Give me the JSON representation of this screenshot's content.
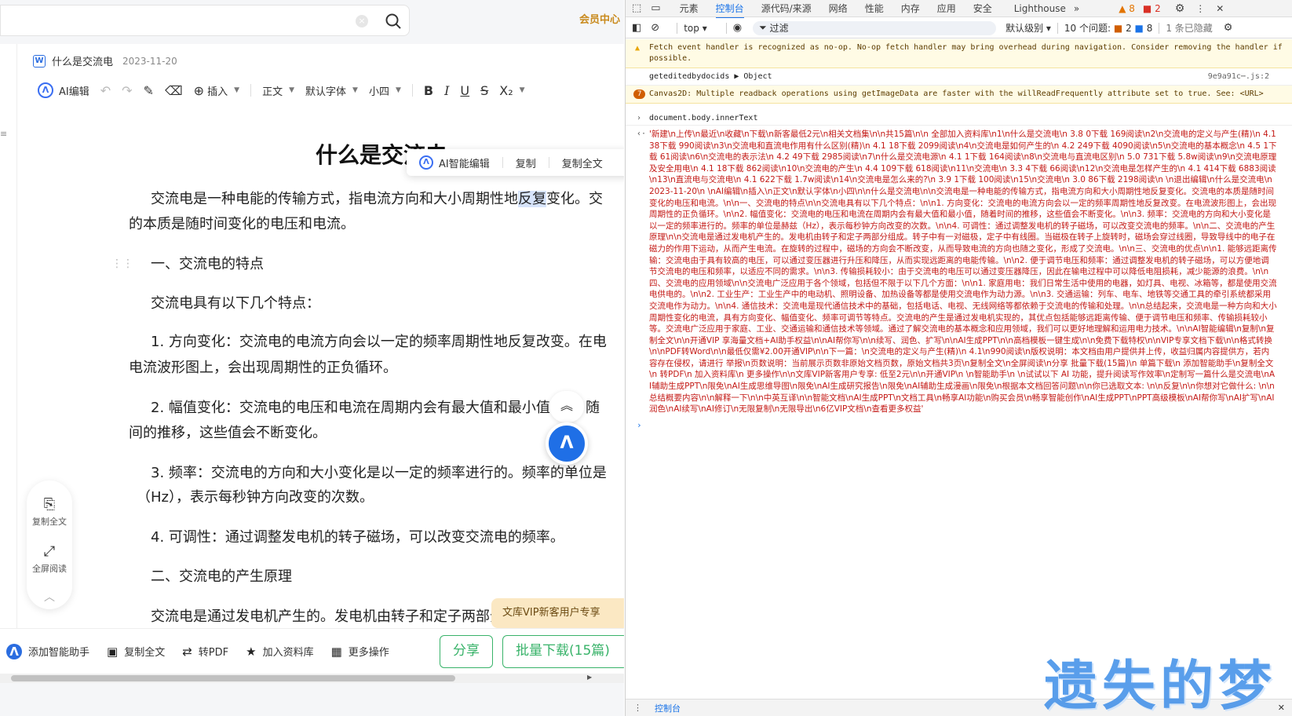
{
  "search": {
    "clear_icon": "×"
  },
  "top_right_link": "会员中心",
  "doc": {
    "file_name": "什么是交流电",
    "date": "2023-11-20",
    "toolbar": {
      "ai_edit": "AI编辑",
      "insert": "插入",
      "style": "正文",
      "font": "默认字体",
      "size": "小四",
      "bold": "B",
      "italic": "I",
      "underline": "U",
      "strike": "S",
      "subscript": "X₂"
    },
    "title": "什么是交流电",
    "ai_popup": {
      "ai": "AI智能编辑",
      "copy": "复制",
      "copy_all": "复制全文"
    },
    "paragraphs": {
      "p1a_pre": "交流电是一种电能的传输方式，指电流方向和大小周期性地",
      "p1a_hl": "反复",
      "p1a_post": "变化。交",
      "p1b": "的本质是随时间变化的电压和电流。",
      "h1": "一、交流电的特点",
      "p2": "交流电具有以下几个特点：",
      "l1a": "1. 方向变化：交流电的电流方向会以一定的频率周期性地反复改变。在电",
      "l1b": "电流波形图上，会出现周期性的正负循环。",
      "l2a": "2. 幅值变化：交流电的电压和电流在周期内会有最大值和最小值",
      "l2a_end": "随",
      "l2b": "间的推移，这些值会不断变化。",
      "l3a": "3. 频率：交流电的方向和大小变化是以一定的频率进行的。频率的单位是",
      "l3b": "（Hz），表示每秒钟方向改变的次数。",
      "l4": "4. 可调性：通过调整发电机的转子磁场，可以改变交流电的频率。",
      "h2": "二、交流电的产生原理",
      "p3": "交流电是通过发电机产生的。发电机由转子和定子两部分"
    }
  },
  "floating": {
    "copy_all": "复制全文",
    "fullscreen": "全屏阅读"
  },
  "vip_banner": "文库VIP新客用户专享",
  "bottom_bar": {
    "add_ai": "添加智能助手",
    "copy_all": "复制全文",
    "to_pdf": "转PDF",
    "add_lib": "加入资料库",
    "more": "更多操作",
    "share": "分享",
    "download": "批量下载(15篇)"
  },
  "devtools": {
    "tabs": [
      "元素",
      "控制台",
      "源代码/来源",
      "网络",
      "性能",
      "内存",
      "应用",
      "安全",
      "Lighthouse"
    ],
    "active_tab": "控制台",
    "warn_count": "8",
    "err_count": "2",
    "context": "top",
    "filter_placeholder": "过滤",
    "level": "默认级别",
    "issues_label": "10 个问题:",
    "issues_warn": "2",
    "issues_info": "8",
    "hidden": "1 条已隐藏",
    "console": {
      "warn1": "Fetch event handler is recognized as no-op. No-op fetch handler may bring overhead during navigation. Consider removing the handler if possible.",
      "log1_text": "geteditedbydocids ▶ Object",
      "log1_src": "9e9a91c⋯.js:2",
      "warn2_count": "7",
      "warn2": "Canvas2D: Multiple readback operations using getImageData are faster with the willReadFrequently attribute set to true. See: <URL>",
      "cmd": "document.body.innerText",
      "result": "'新建\\n上传\\n最近\\n收藏\\n下载\\n新客最低2元\\n相关文档集\\n\\n共15篇\\n\\n 全部加入资料库\\n1\\n什么是交流电\\n 3.8 0下载 169阅读\\n2\\n交流电的定义与产生(精)\\n 4.1 38下载 990阅读\\n3\\n交流电和直流电作用有什么区别(精)\\n 4.1 18下载 2099阅读\\n4\\n交流电是如何产生的\\n 4.2 249下载 4090阅读\\n5\\n交流电的基本概念\\n 4.5 1下载 61阅读\\n6\\n交流电的表示法\\n 4.2 49下载 2985阅读\\n7\\n什么是交流电源\\n 4.1 1下载 164阅读\\n8\\n交流电与直流电区别\\n 5.0 731下载 5.8w阅读\\n9\\n交流电原理及安全用电\\n 4.1 18下载 862阅读\\n10\\n交流电的产生\\n 4.4 109下载 618阅读\\n11\\n交流电\\n 3.3 4下载 66阅读\\n12\\n交流电是怎样产生的\\n 4.1 414下载 6883阅读\\n13\\n直流电与交流电\\n 4.1 622下载 1.7w阅读\\n14\\n交流电是怎么来的?\\n 3.9 1下载 100阅读\\n15\\n交流电\\n 3.0 86下载 2198阅读\\n \\n退出编辑\\n什么是交流电\\n2023-11-20\\n    \\nAI编辑\\n插入\\n正文\\n默认字体\\n小四\\n\\n什么是交流电\\n\\n交流电是一种电能的传输方式，指电流方向和大小周期性地反复变化。交流电的本质是随时间变化的电压和电流。\\n\\n一、交流电的特点\\n\\n交流电具有以下几个特点：\\n\\n1. 方向变化：交流电的电流方向会以一定的频率周期性地反复改变。在电流波形图上，会出现周期性的正负循环。\\n\\n2. 幅值变化：交流电的电压和电流在周期内会有最大值和最小值，随着时间的推移，这些值会不断变化。\\n\\n3. 频率：交流电的方向和大小变化是以一定的频率进行的。频率的单位是赫兹（Hz），表示每秒钟方向改变的次数。\\n\\n4. 可调性：通过调整发电机的转子磁场，可以改变交流电的频率。\\n\\n二、交流电的产生原理\\n\\n交流电是通过发电机产生的。发电机由转子和定子两部分组成。转子中有一对磁极，定子中有线圈。当磁极在转子上旋转时，磁场会穿过线圈，导致导线中的电子在磁力的作用下运动，从而产生电流。在旋转的过程中，磁场的方向会不断改变，从而导致电流的方向也随之变化，形成了交流电。\\n\\n三、交流电的优点\\n\\n1. 能够远距离传输：交流电由于具有较高的电压，可以通过变压器进行升压和降压，从而实现远距离的电能传输。\\n\\n2. 便于调节电压和频率：通过调整发电机的转子磁场，可以方便地调节交流电的电压和频率，以适应不同的需求。\\n\\n3. 传输损耗较小：由于交流电的电压可以通过变压器降压，因此在输电过程中可以降低电阻损耗，减少能源的浪费。\\n\\n四、交流电的应用领域\\n\\n交流电广泛应用于各个领域，包括但不限于以下几个方面：\\n\\n1. 家庭用电：我们日常生活中使用的电器，如灯具、电视、冰箱等，都是使用交流电供电的。\\n\\n2. 工业生产：工业生产中的电动机、照明设备、加热设备等都是使用交流电作为动力源。\\n\\n3. 交通运输：列车、电车、地铁等交通工具的牵引系统都采用交流电作为动力。\\n\\n4. 通信技术：交流电是现代通信技术中的基础，包括电话、电视、无线网络等都依赖于交流电的传输和处理。\\n\\n总结起来，交流电是一种方向和大小周期性变化的电流，具有方向变化、幅值变化、频率可调节等特点。交流电的产生是通过发电机实现的，其优点包括能够远距离传输、便于调节电压和频率、传输损耗较小等。交流电广泛应用于家庭、工业、交通运输和通信技术等领域。通过了解交流电的基本概念和应用领域，我们可以更好地理解和运用电力技术。\\n\\nAI智能编辑\\n复制\\n复制全文\\n\\n开通VIP 享海量文档+AI助手权益\\n\\nAI帮你写\\n\\n续写、润色、扩写\\n\\nAI生成PPT\\n\\n高档模板一键生成\\n\\n免费下载特权\\n\\nVIP专享文档下载\\n\\n格式转换\\n\\nPDF转Word\\n\\n最低仅需¥2.00开通VIP\\n\\n下一篇：\\n交流电的定义与产生(精)\\n 4.1\\n990阅读\\n版权说明：本文档由用户提供并上传，收益归属内容提供方，若内容存在侵权，请进行 举报\\n页数说明：当前展示页数非原始文档页数，原始文档共3页\\n复制全文\\n全屏阅读\\n分享 批量下载(15篇)\\n 单篇下载\\n 添加智能助手\\n复制全文\\n 转PDF\\n 加入资料库\\n 更多操作\\n\\n文库VIP新客用户专享: 低至2元\\n\\n开通VIP\\n \\n智能助手\\n \\n试试以下 AI 功能，提升阅读写作效率\\n定制写一篇什么是交流电\\nAI辅助生成PPT\\n限免\\nAI生成思维导图\\n限免\\nAI生成研究报告\\n限免\\nAI辅助生成漫画\\n限免\\n根据本文档回答问题\\n\\n你已选取文本: \\n\\n反复\\n\\n你想对它做什么: \\n\\n总结概要内容\\n\\n解释一下\\n\\n中英互译\\n\\n智能文档\\nAI生成PPT\\n文档工具\\n畅享AI功能\\n购买会员\\n畅享智能创作\\nAI生成PPT\\nPPT高级模板\\nAI帮你写\\nAI扩写\\nAI润色\\nAI续写\\nAI修订\\n无限复制\\n无限导出\\n6亿VIP文档\\n查看更多权益'"
    },
    "bottom_tab": "控制台"
  },
  "watermark": "遗失的梦",
  "colors": {
    "accent": "#1a73e8",
    "brand_green": "#39b36a",
    "vip_gold": "#c98a1d",
    "ai_blue": "#1f6fe6"
  },
  "icons": [
    "search-icon",
    "undo-icon",
    "redo-icon",
    "format-brush-icon",
    "eraser-icon",
    "plus-circle-icon",
    "copy-icon",
    "fullscreen-icon",
    "chevron-up-icon",
    "pdf-icon",
    "star-icon",
    "grid-icon",
    "gear-icon",
    "more-icon"
  ]
}
